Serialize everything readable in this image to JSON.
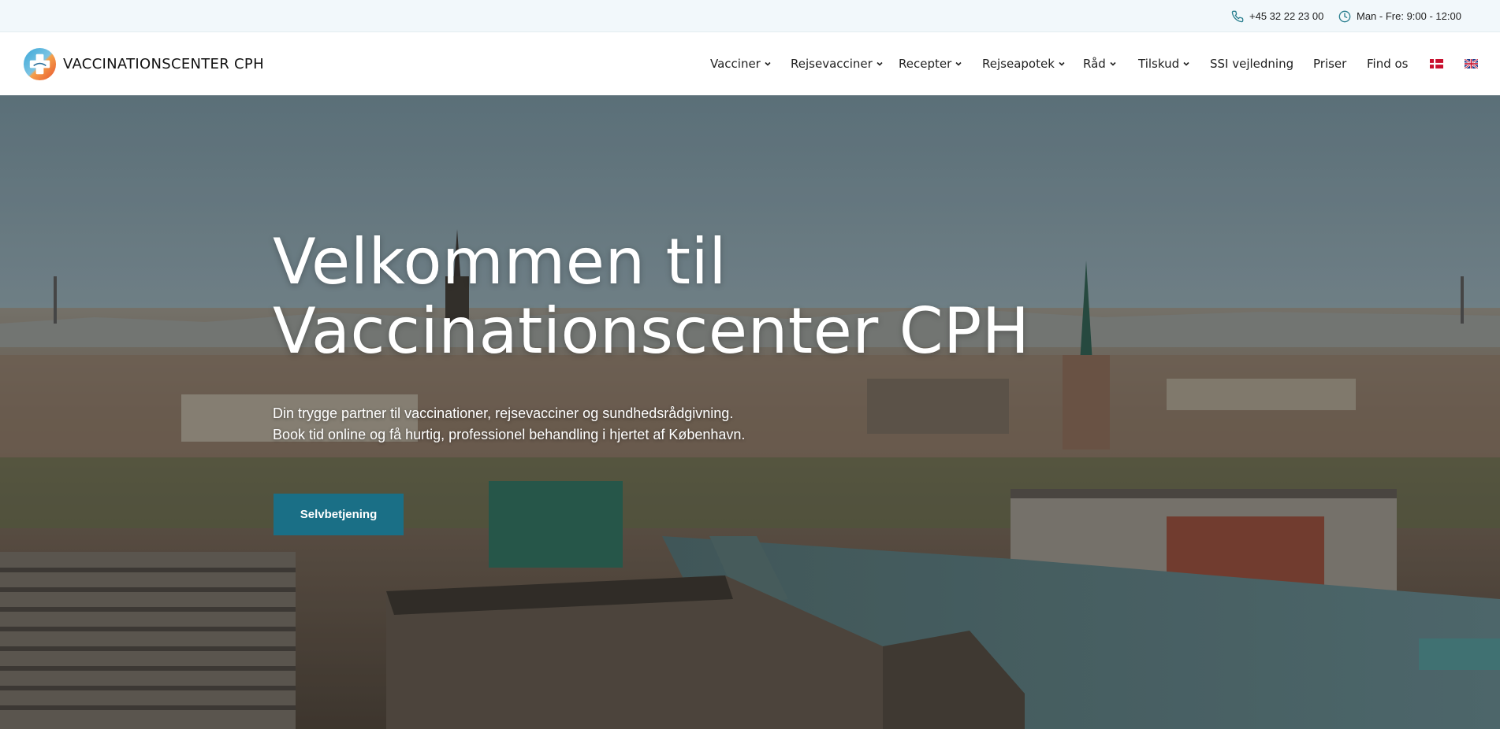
{
  "topbar": {
    "phone": "+45 32 22 23 00",
    "hours": "Man - Fre: 9:00 - 12:00"
  },
  "header": {
    "brand_name": "VACCINATIONSCENTER CPH",
    "nav": [
      {
        "label": "Vacciner",
        "has_dropdown": true
      },
      {
        "label": "Rejsevacciner",
        "has_dropdown": true
      },
      {
        "label": "Recepter",
        "has_dropdown": true
      },
      {
        "label": "Rejseapotek",
        "has_dropdown": true
      },
      {
        "label": "Råd",
        "has_dropdown": true
      },
      {
        "label": "Tilskud",
        "has_dropdown": true
      },
      {
        "label": "SSI vejledning",
        "has_dropdown": false
      },
      {
        "label": "Priser",
        "has_dropdown": false
      },
      {
        "label": "Find os",
        "has_dropdown": false
      }
    ],
    "languages": [
      "danish-flag-icon",
      "uk-flag-icon"
    ]
  },
  "hero": {
    "title_line1": "Velkommen til",
    "title_line2": "Vaccinationscenter CPH",
    "text_line1": "Din trygge partner til vaccinationer, rejsevacciner og sundhedsrådgivning.",
    "text_line2": "Book tid online og få hurtig, professionel behandling i hjertet af København.",
    "button_label": "Selvbetjening"
  },
  "colors": {
    "accent": "#1a6f86",
    "topbar_bg": "#f2f8fb",
    "icon_teal": "#2a7f8f"
  }
}
